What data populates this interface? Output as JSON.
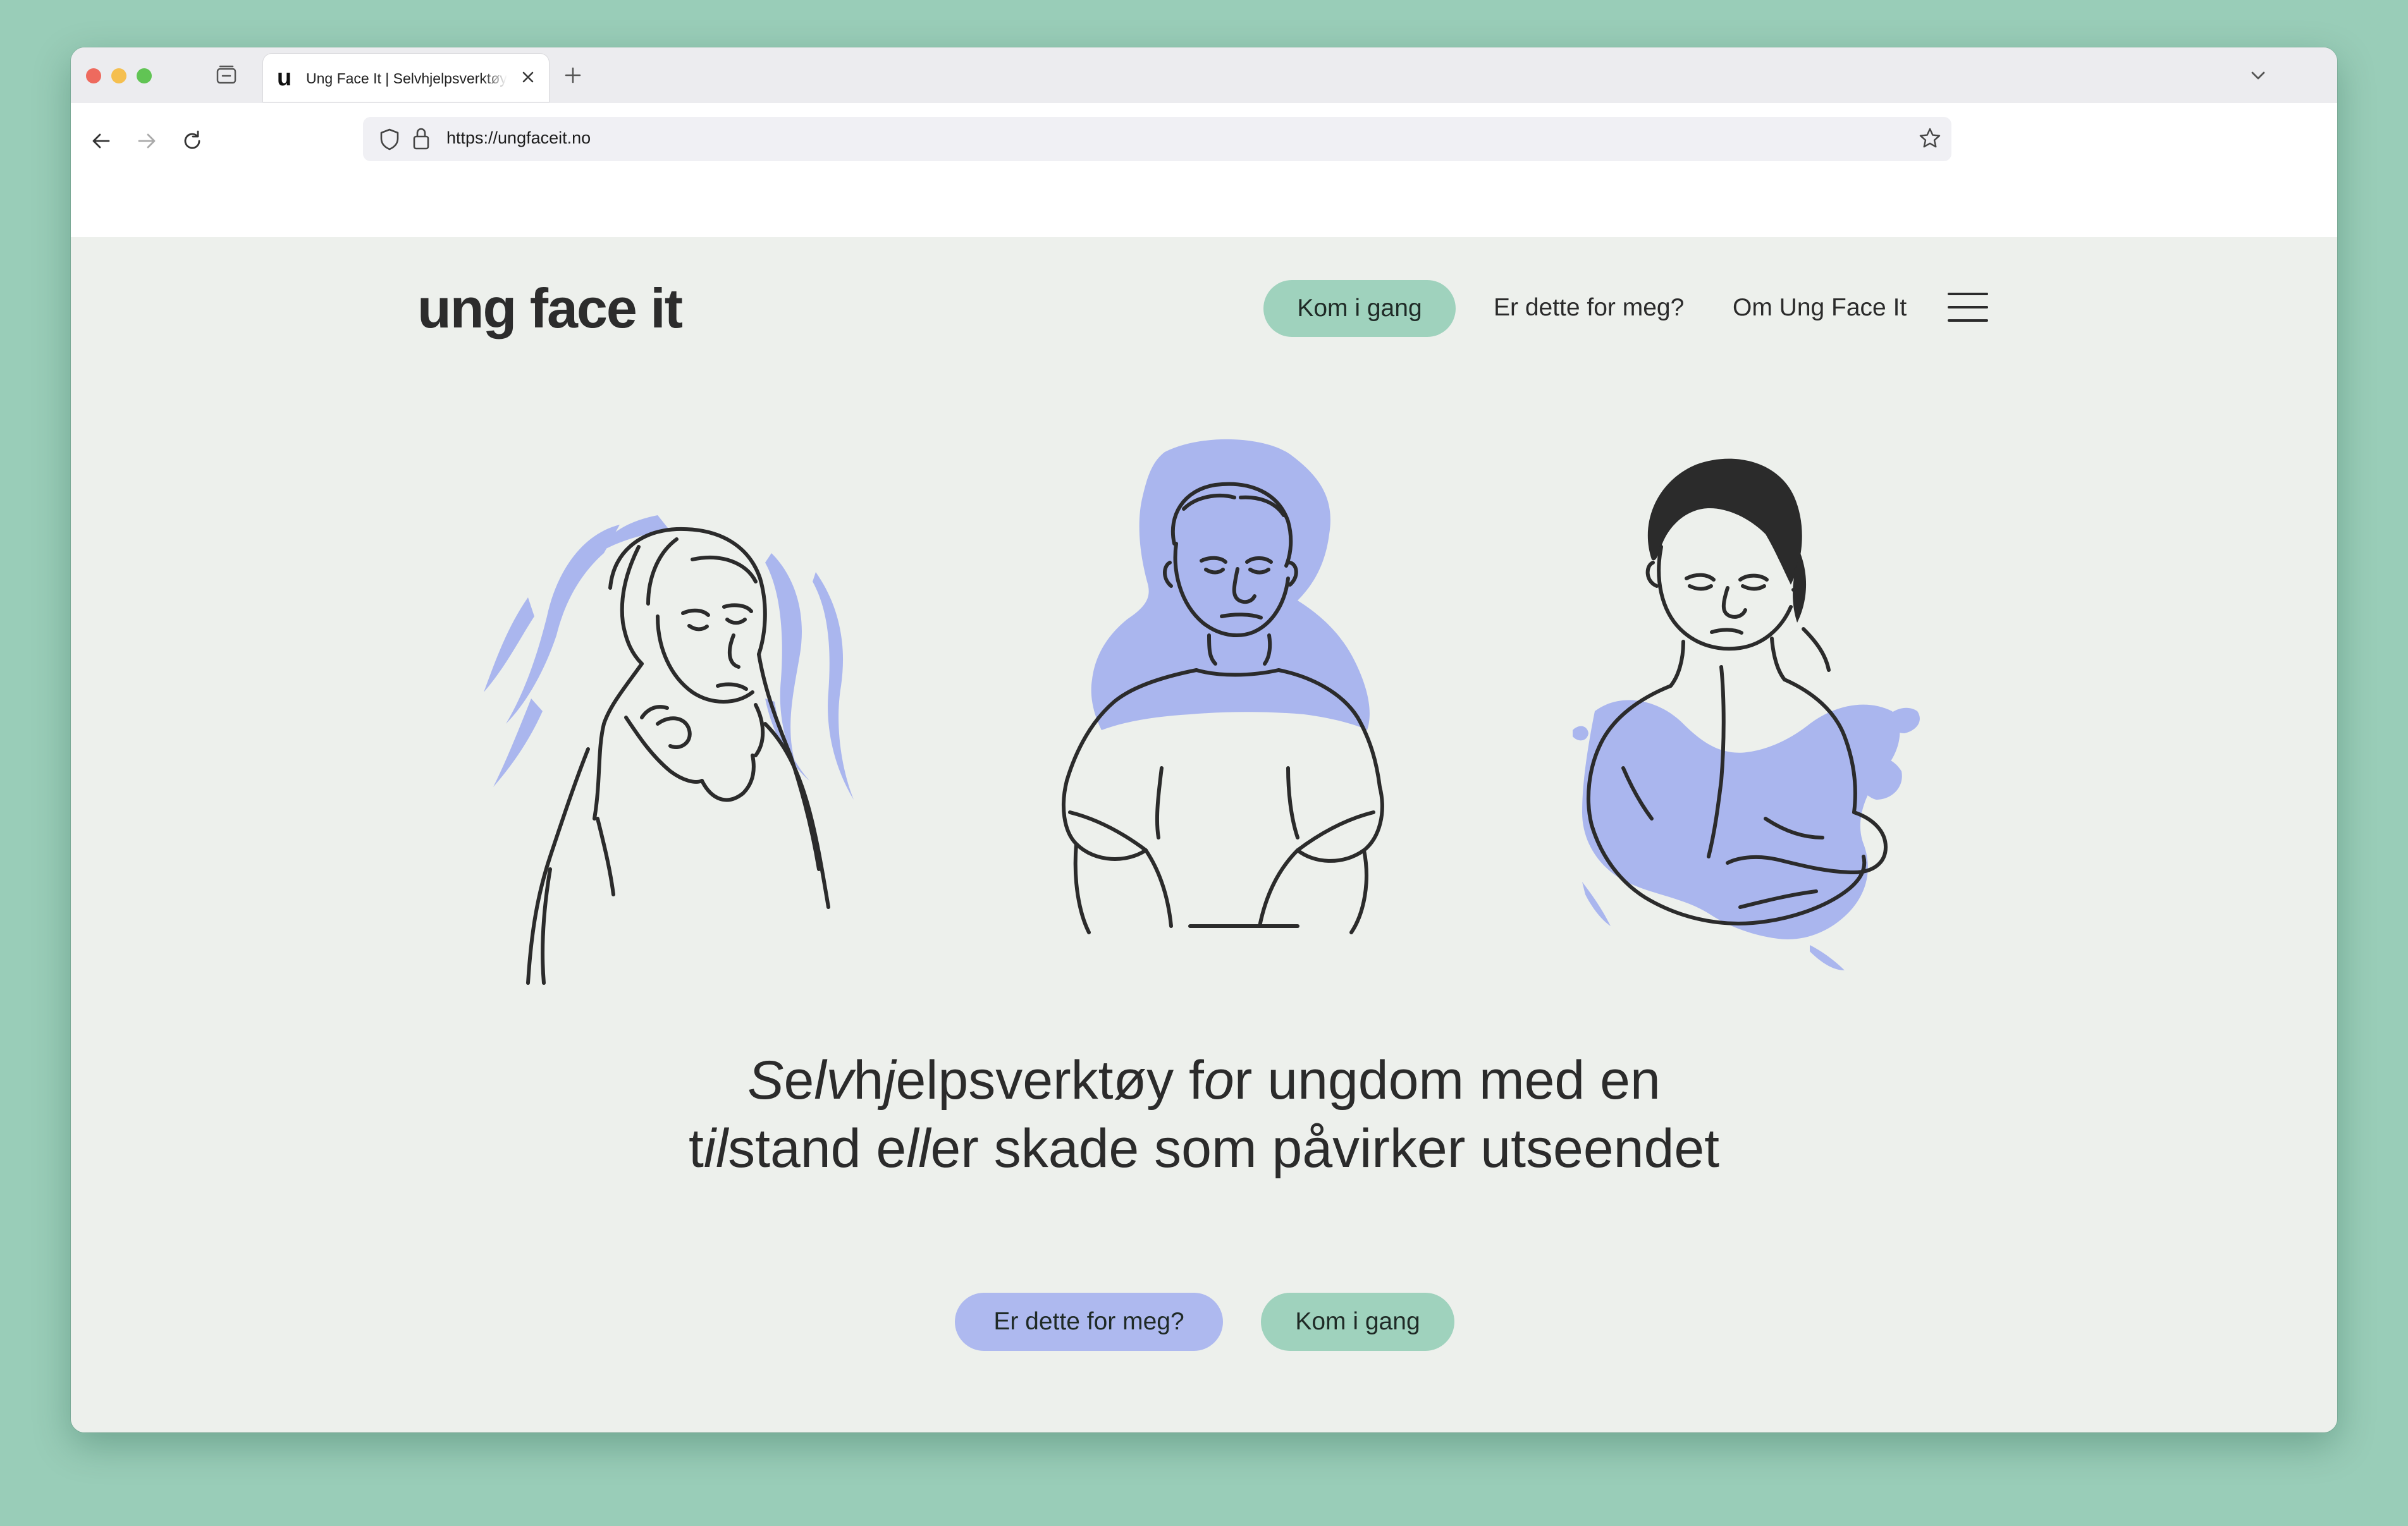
{
  "browser": {
    "tab_title": "Ung Face It | Selvhjelpsverktøy for ungdom",
    "tab_favicon": "u",
    "url": "https://ungfaceit.no",
    "icons": {
      "tab_overview": "tab-overview-icon",
      "close_tab": "close-icon",
      "new_tab": "plus-icon",
      "list_all_tabs": "chevron-down-icon",
      "back": "arrow-left-icon",
      "forward": "arrow-right-icon",
      "reload": "reload-icon",
      "tracking_protection": "shield-icon",
      "secure": "lock-icon",
      "bookmark": "star-icon"
    }
  },
  "site": {
    "logo": "ung face it",
    "nav": {
      "cta": "Kom i gang",
      "links": [
        "Er dette for meg?",
        "Om Ung Face It"
      ],
      "menu_icon": "hamburger-menu-icon"
    },
    "hero": {
      "headline_parts": [
        "S",
        "e",
        "lv",
        "h",
        "j",
        "elpsverktøy f",
        "o",
        "r ungdom med en ",
        "t",
        "il",
        "stand e",
        "ll",
        "er skade som påvirker utseendet"
      ],
      "buttons": {
        "primary": "Er dette for meg?",
        "secondary": "Kom i gang"
      }
    }
  },
  "colors": {
    "background": "#99cdb8",
    "page": "#edf0ec",
    "green_button": "#9fd2bd",
    "purple_button": "#aeb9ef",
    "illustration_accent": "#aab6ee",
    "ink": "#2b2b2b"
  }
}
